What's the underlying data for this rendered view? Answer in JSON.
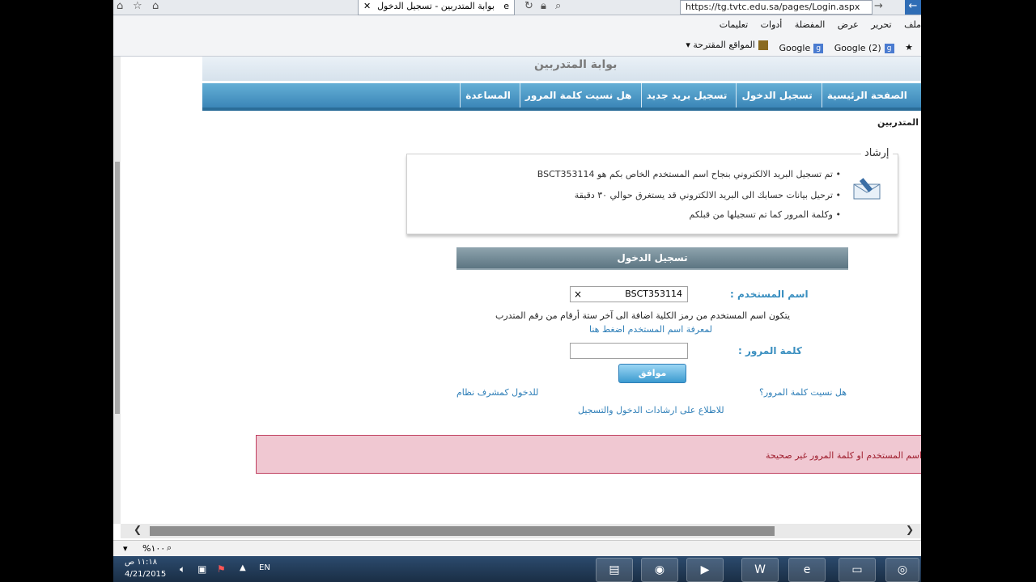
{
  "browser": {
    "tab_title": "بوابة المتدربين - تسجيل الدخول",
    "url": "https://tg.tvtc.edu.sa/pages/Login.aspx",
    "menu": [
      "ملف",
      "تحرير",
      "عرض",
      "المفضلة",
      "أدوات",
      "تعليمات"
    ],
    "favorites": [
      "Google (2)",
      "Google",
      "المواقع المقترحة ▾"
    ],
    "zoom": "١٠٠%"
  },
  "site": {
    "banner_title": "بوابة المتدربين",
    "nav": [
      "الصفحة الرئيسية",
      "تسجيل الدخول",
      "تسجيل بريد جديد",
      "هل نسيت كلمة المرور",
      "المساعدة"
    ],
    "breadcrumb": "المتدربين"
  },
  "guide": {
    "legend": "إرشاد",
    "lines": [
      "تم تسجيل البريد الالكتروني بنجاح اسم المستخدم الخاص بكم هو BSCT353114",
      "ترحيل بيانات حسابك الى البريد الالكتروني قد يستغرق حوالي ٣٠ دقيقة",
      "وكلمة المرور كما تم تسجيلها من قبلكم"
    ]
  },
  "login": {
    "header": "تسجيل الدخول",
    "username_label": "اسم المستخدم :",
    "username_value": "BSCT353114",
    "clear": "×",
    "username_hint": "يتكون اسم المستخدم من رمز الكلية اضافة الى آخر ستة أرقام من رقم المتدرب",
    "username_link": "لمعرفة اسم المستخدم اضغط هنا",
    "password_label": "كلمة المرور :",
    "password_value": "",
    "ok_button": "موافق",
    "forgot_link": "هل نسيت كلمة المرور؟",
    "supervisor_link": "للدخول كمشرف نظام",
    "instructions_link": "للاطلاع على ارشادات الدخول والتسجيل"
  },
  "error": {
    "message": "اسم المستخدم او كلمة المرور غير صحيحة"
  },
  "taskbar": {
    "lang": "EN",
    "time": "١١:١٨ ص",
    "date": "4/21/2015"
  }
}
